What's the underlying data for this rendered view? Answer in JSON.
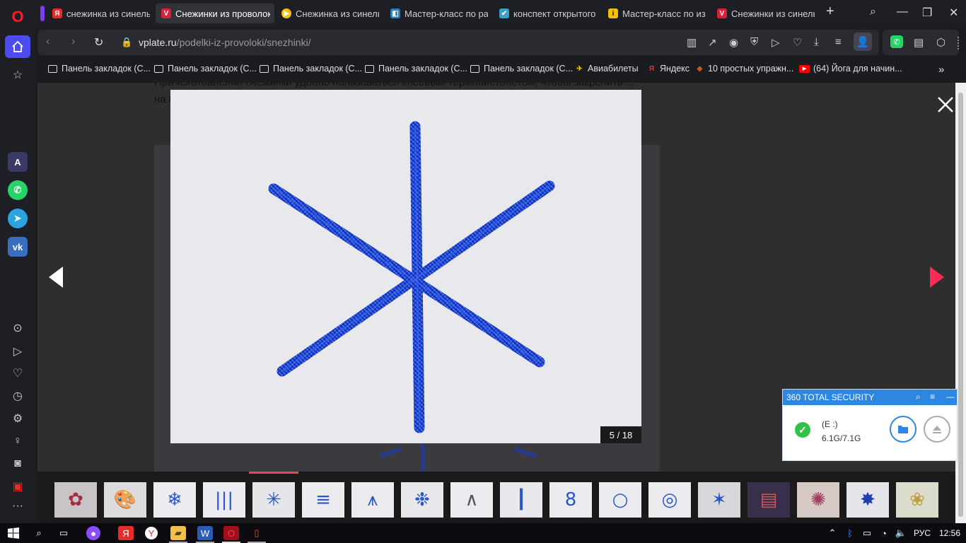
{
  "browser": {
    "tabs": [
      {
        "label": "снежинка из синельно",
        "favicon": "Я",
        "fav_color": "#e62c2c",
        "active": false
      },
      {
        "label": "Снежинки из проволоки",
        "favicon": "V",
        "fav_color": "#d9213a",
        "active": true
      },
      {
        "label": "Снежинка из синельно",
        "favicon": "▶",
        "fav_color": "#f2c100",
        "active": false
      },
      {
        "label": "Мастер-класс по разв",
        "favicon": "◧",
        "fav_color": "#2c7fbf",
        "active": false
      },
      {
        "label": "конспект открытого за",
        "favicon": "✔",
        "fav_color": "#3aa0c8",
        "active": false
      },
      {
        "label": "Мастер-класс по изго",
        "favicon": "i",
        "fav_color": "#f2c100",
        "active": false
      },
      {
        "label": "Снежинки из синельн",
        "favicon": "V",
        "fav_color": "#d9213a",
        "active": false
      }
    ],
    "url_host": "vplate.ru",
    "url_path": "/podelki-iz-provoloki/snezhinki/",
    "bookmarks": [
      {
        "label": "Панель закладок (С...",
        "kind": "folder"
      },
      {
        "label": "Панель закладок (С...",
        "kind": "folder"
      },
      {
        "label": "Панель закладок (С...",
        "kind": "folder"
      },
      {
        "label": "Панель закладок (С...",
        "kind": "folder"
      },
      {
        "label": "Панель закладок (С...",
        "kind": "folder"
      },
      {
        "label": "Авиабилеты",
        "kind": "site",
        "icon": "✈",
        "color": "#f2c100"
      },
      {
        "label": "Яндекс",
        "kind": "site",
        "icon": "Я",
        "color": "#e62c2c"
      },
      {
        "label": "10 простых упражн...",
        "kind": "site",
        "icon": "◆",
        "color": "#c85a1e"
      },
      {
        "label": "(64) Йога для начин...",
        "kind": "site",
        "icon": "▶",
        "color": "#ff0000"
      }
    ]
  },
  "page": {
    "background_text": "При изготовлении снежинки удобно пользоваться клеевым термопистолетом, чтобы закрепить ... на пол...",
    "gallery": {
      "counter": "5 / 18",
      "current_index": 5,
      "total": 18,
      "thumbnails": [
        {
          "name": "thumb-1",
          "bg": "#c9c3c7"
        },
        {
          "name": "thumb-2",
          "bg": "#dcdcdc"
        },
        {
          "name": "thumb-3",
          "bg": "#ececf0"
        },
        {
          "name": "thumb-4",
          "bg": "#ececf0"
        },
        {
          "name": "thumb-5",
          "bg": "#e6e6ea"
        },
        {
          "name": "thumb-6",
          "bg": "#ececf0"
        },
        {
          "name": "thumb-7",
          "bg": "#ececf0"
        },
        {
          "name": "thumb-8",
          "bg": "#e8e8ec"
        },
        {
          "name": "thumb-9",
          "bg": "#ececf0"
        },
        {
          "name": "thumb-10",
          "bg": "#e8e8ec"
        },
        {
          "name": "thumb-11",
          "bg": "#ececf0"
        },
        {
          "name": "thumb-12",
          "bg": "#ececf0"
        },
        {
          "name": "thumb-13",
          "bg": "#ececf0"
        },
        {
          "name": "thumb-14",
          "bg": "#d8d8dc"
        },
        {
          "name": "thumb-15",
          "bg": "#3a2f4a"
        },
        {
          "name": "thumb-16",
          "bg": "#d6c8c4"
        },
        {
          "name": "thumb-17",
          "bg": "#e4e4ea"
        },
        {
          "name": "thumb-18",
          "bg": "#dcdccc"
        }
      ]
    }
  },
  "security_widget": {
    "title": "360 TOTAL SECURITY",
    "drive_name": "(E :)",
    "drive_size": "6.1G/7.1G"
  },
  "taskbar": {
    "language": "РУС",
    "time": "12:56"
  },
  "colors": {
    "accent": "#e5484d",
    "opera_red": "#ff1b2d",
    "security_blue": "#2d86e0"
  }
}
